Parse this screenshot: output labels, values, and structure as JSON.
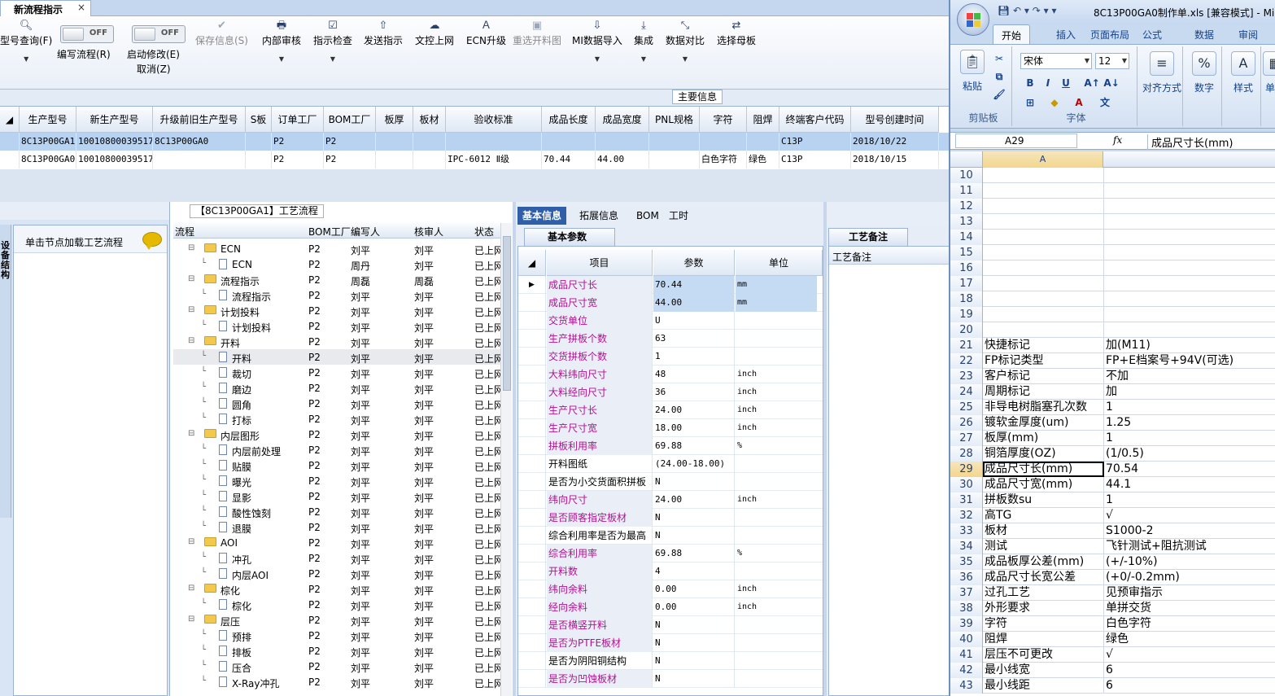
{
  "app": {
    "tab_title": "新流程指示",
    "tab_close": "×",
    "ribbon": {
      "query": "型号查询(F)",
      "edit_flow": "编写流程(R)",
      "start_modify": "启动修改(E)",
      "cancel": "取消(Z)",
      "toggle_off_1": "OFF",
      "toggle_off_2": "OFF",
      "save_info": "保存信息(S)",
      "internal_review": "内部审核",
      "instruction_check": "指示检查",
      "send_instruction": "发送指示",
      "file_upload": "文控上网",
      "ecn_upgrade": "ECN升级",
      "reselect_panel": "重选开料图",
      "mi_import": "MI数据导入",
      "integrate": "集成",
      "data_compare": "数据对比",
      "select_master": "选择母板"
    },
    "main_info_label": "主要信息",
    "top_grid": {
      "headers": [
        "生产型号",
        "新生产型号",
        "升级前旧生产型号",
        "S板",
        "订单工厂",
        "BOM工厂",
        "板厚",
        "板材",
        "验收标准",
        "成品长度",
        "成品宽度",
        "PNL规格",
        "字符",
        "阻焊",
        "终端客户代码",
        "型号创建时间"
      ],
      "rows": [
        [
          "8C13P00GA1",
          "10010800039517",
          "8C13P00GA0",
          "",
          "P2",
          "P2",
          "",
          "",
          "",
          "",
          "",
          "",
          "",
          "",
          "C13P",
          "2018/10/22"
        ],
        [
          "8C13P00GA0",
          "10010800039517",
          "",
          "",
          "P2",
          "P2",
          "",
          "",
          "IPC-6012 Ⅱ级",
          "70.44",
          "44.00",
          "",
          "白色字符",
          "绿色",
          "C13P",
          "2018/10/15"
        ]
      ]
    },
    "node_panel": {
      "side_tab": "设备结构",
      "hint": "单击节点加载工艺流程"
    },
    "tree": {
      "caption": "【8C13P00GA1】工艺流程",
      "headers": [
        "流程",
        "BOM工厂",
        "编写人",
        "核审人",
        "状态"
      ],
      "rows": [
        {
          "name": "ECN",
          "level": 0,
          "bom": "P2",
          "writer": "刘平",
          "reviewer": "刘平",
          "status": "已上网"
        },
        {
          "name": "ECN",
          "level": 1,
          "bom": "P2",
          "writer": "周丹",
          "reviewer": "刘平",
          "status": "已上网"
        },
        {
          "name": "流程指示",
          "level": 0,
          "bom": "P2",
          "writer": "周磊",
          "reviewer": "周磊",
          "status": "已上网"
        },
        {
          "name": "流程指示",
          "level": 1,
          "bom": "P2",
          "writer": "刘平",
          "reviewer": "刘平",
          "status": "已上网"
        },
        {
          "name": "计划投料",
          "level": 0,
          "bom": "P2",
          "writer": "刘平",
          "reviewer": "刘平",
          "status": "已上网"
        },
        {
          "name": "计划投料",
          "level": 1,
          "bom": "P2",
          "writer": "刘平",
          "reviewer": "刘平",
          "status": "已上网"
        },
        {
          "name": "开料",
          "level": 0,
          "bom": "P2",
          "writer": "刘平",
          "reviewer": "刘平",
          "status": "已上网"
        },
        {
          "name": "开料",
          "level": 1,
          "bom": "P2",
          "writer": "刘平",
          "reviewer": "刘平",
          "status": "已上网"
        },
        {
          "name": "裁切",
          "level": 1,
          "bom": "P2",
          "writer": "刘平",
          "reviewer": "刘平",
          "status": "已上网"
        },
        {
          "name": "磨边",
          "level": 1,
          "bom": "P2",
          "writer": "刘平",
          "reviewer": "刘平",
          "status": "已上网"
        },
        {
          "name": "圆角",
          "level": 1,
          "bom": "P2",
          "writer": "刘平",
          "reviewer": "刘平",
          "status": "已上网"
        },
        {
          "name": "打标",
          "level": 1,
          "bom": "P2",
          "writer": "刘平",
          "reviewer": "刘平",
          "status": "已上网"
        },
        {
          "name": "内层图形",
          "level": 0,
          "bom": "P2",
          "writer": "刘平",
          "reviewer": "刘平",
          "status": "已上网"
        },
        {
          "name": "内层前处理",
          "level": 1,
          "bom": "P2",
          "writer": "刘平",
          "reviewer": "刘平",
          "status": "已上网"
        },
        {
          "name": "贴膜",
          "level": 1,
          "bom": "P2",
          "writer": "刘平",
          "reviewer": "刘平",
          "status": "已上网"
        },
        {
          "name": "曝光",
          "level": 1,
          "bom": "P2",
          "writer": "刘平",
          "reviewer": "刘平",
          "status": "已上网"
        },
        {
          "name": "显影",
          "level": 1,
          "bom": "P2",
          "writer": "刘平",
          "reviewer": "刘平",
          "status": "已上网"
        },
        {
          "name": "酸性蚀刻",
          "level": 1,
          "bom": "P2",
          "writer": "刘平",
          "reviewer": "刘平",
          "status": "已上网"
        },
        {
          "name": "退膜",
          "level": 1,
          "bom": "P2",
          "writer": "刘平",
          "reviewer": "刘平",
          "status": "已上网"
        },
        {
          "name": "AOI",
          "level": 0,
          "bom": "P2",
          "writer": "刘平",
          "reviewer": "刘平",
          "status": "已上网"
        },
        {
          "name": "冲孔",
          "level": 1,
          "bom": "P2",
          "writer": "刘平",
          "reviewer": "刘平",
          "status": "已上网"
        },
        {
          "name": "内层AOI",
          "level": 1,
          "bom": "P2",
          "writer": "刘平",
          "reviewer": "刘平",
          "status": "已上网"
        },
        {
          "name": "棕化",
          "level": 0,
          "bom": "P2",
          "writer": "刘平",
          "reviewer": "刘平",
          "status": "已上网"
        },
        {
          "name": "棕化",
          "level": 1,
          "bom": "P2",
          "writer": "刘平",
          "reviewer": "刘平",
          "status": "已上网"
        },
        {
          "name": "层压",
          "level": 0,
          "bom": "P2",
          "writer": "刘平",
          "reviewer": "刘平",
          "status": "已上网"
        },
        {
          "name": "预排",
          "level": 1,
          "bom": "P2",
          "writer": "刘平",
          "reviewer": "刘平",
          "status": "已上网"
        },
        {
          "name": "排板",
          "level": 1,
          "bom": "P2",
          "writer": "刘平",
          "reviewer": "刘平",
          "status": "已上网"
        },
        {
          "name": "压合",
          "level": 1,
          "bom": "P2",
          "writer": "刘平",
          "reviewer": "刘平",
          "status": "已上网"
        },
        {
          "name": "X-Ray冲孔",
          "level": 1,
          "bom": "P2",
          "writer": "刘平",
          "reviewer": "刘平",
          "status": "已上网"
        }
      ]
    },
    "params": {
      "tabs": [
        "基本信息",
        "拓展信息",
        "BOM",
        "工时"
      ],
      "sub_tab": "基本参数",
      "headers": [
        "项目",
        "参数",
        "单位"
      ],
      "rows": [
        {
          "name": "成品尺寸长",
          "value": "70.44",
          "unit": "mm",
          "req": true
        },
        {
          "name": "成品尺寸宽",
          "value": "44.00",
          "unit": "mm",
          "req": true
        },
        {
          "name": "交货单位",
          "value": "U",
          "unit": "",
          "req": true
        },
        {
          "name": "生产拼板个数",
          "value": "63",
          "unit": "",
          "req": true
        },
        {
          "name": "交货拼板个数",
          "value": "1",
          "unit": "",
          "req": true
        },
        {
          "name": "大料纬向尺寸",
          "value": "48",
          "unit": "inch",
          "req": true
        },
        {
          "name": "大料经向尺寸",
          "value": "36",
          "unit": "inch",
          "req": true
        },
        {
          "name": "生产尺寸长",
          "value": "24.00",
          "unit": "inch",
          "req": true
        },
        {
          "name": "生产尺寸宽",
          "value": "18.00",
          "unit": "inch",
          "req": true
        },
        {
          "name": "拼板利用率",
          "value": "69.88",
          "unit": "%",
          "req": true
        },
        {
          "name": "开料图纸",
          "value": "(24.00-18.00)",
          "unit": "",
          "req": false
        },
        {
          "name": "是否为小交货面积拼板",
          "value": "N",
          "unit": "",
          "req": false
        },
        {
          "name": "纬向尺寸",
          "value": "24.00",
          "unit": "inch",
          "req": true
        },
        {
          "name": "是否顾客指定板材",
          "value": "N",
          "unit": "",
          "req": true
        },
        {
          "name": "综合利用率是否为最高",
          "value": "N",
          "unit": "",
          "req": false
        },
        {
          "name": "综合利用率",
          "value": "69.88",
          "unit": "%",
          "req": true
        },
        {
          "name": "开料数",
          "value": "4",
          "unit": "",
          "req": true
        },
        {
          "name": "纬向余料",
          "value": "0.00",
          "unit": "inch",
          "req": true
        },
        {
          "name": "经向余料",
          "value": "0.00",
          "unit": "inch",
          "req": true
        },
        {
          "name": "是否横竖开料",
          "value": "N",
          "unit": "",
          "req": true
        },
        {
          "name": "是否为PTFE板材",
          "value": "N",
          "unit": "",
          "req": true
        },
        {
          "name": "是否为阴阳铜结构",
          "value": "N",
          "unit": "",
          "req": false
        },
        {
          "name": "是否为凹蚀板材",
          "value": "N",
          "unit": "",
          "req": true
        }
      ]
    },
    "notes": {
      "tab": "工艺备注",
      "label": "工艺备注"
    }
  },
  "excel": {
    "title": "8C13P00GA0制作单.xls  [兼容模式] - Mic",
    "tabs": [
      "开始",
      "插入",
      "页面布局",
      "公式",
      "数据",
      "审阅"
    ],
    "ribbon": {
      "paste": "粘贴",
      "clipboard": "剪贴板",
      "font_name": "宋体",
      "font_size": "12",
      "font_group": "字体",
      "align": "对齐方式",
      "number": "数字",
      "style": "样式",
      "cells": "单元"
    },
    "name_box": "A29",
    "formula": "成品尺寸长(mm)",
    "col_a": "A",
    "rows": [
      {
        "n": "10",
        "a": "",
        "b": ""
      },
      {
        "n": "11",
        "a": "",
        "b": ""
      },
      {
        "n": "12",
        "a": "",
        "b": ""
      },
      {
        "n": "13",
        "a": "",
        "b": ""
      },
      {
        "n": "14",
        "a": "",
        "b": ""
      },
      {
        "n": "15",
        "a": "",
        "b": ""
      },
      {
        "n": "16",
        "a": "",
        "b": ""
      },
      {
        "n": "17",
        "a": "",
        "b": ""
      },
      {
        "n": "18",
        "a": "",
        "b": ""
      },
      {
        "n": "19",
        "a": "",
        "b": ""
      },
      {
        "n": "20",
        "a": "",
        "b": ""
      },
      {
        "n": "21",
        "a": "快捷标记",
        "b": "加(M11)"
      },
      {
        "n": "22",
        "a": "FP标记类型",
        "b": "FP+E档案号+94V(可选)"
      },
      {
        "n": "23",
        "a": "客户标记",
        "b": "不加"
      },
      {
        "n": "24",
        "a": "周期标记",
        "b": "加"
      },
      {
        "n": "25",
        "a": "非导电树脂塞孔次数",
        "b": "1"
      },
      {
        "n": "26",
        "a": "镀软金厚度(um)",
        "b": "1.25"
      },
      {
        "n": "27",
        "a": "板厚(mm)",
        "b": "1"
      },
      {
        "n": "28",
        "a": "铜箔厚度(OZ)",
        "b": "(1/0.5)"
      },
      {
        "n": "29",
        "a": "成品尺寸长(mm)",
        "b": "70.54"
      },
      {
        "n": "30",
        "a": "成品尺寸宽(mm)",
        "b": "44.1"
      },
      {
        "n": "31",
        "a": "拼板数su",
        "b": "1"
      },
      {
        "n": "32",
        "a": "高TG",
        "b": "√"
      },
      {
        "n": "33",
        "a": "板材",
        "b": "S1000-2"
      },
      {
        "n": "34",
        "a": "测试",
        "b": "飞针测试+阻抗测试"
      },
      {
        "n": "35",
        "a": "成品板厚公差(mm)",
        "b": "(+/-10%)"
      },
      {
        "n": "36",
        "a": "成品尺寸长宽公差",
        "b": "(+0/-0.2mm)"
      },
      {
        "n": "37",
        "a": "过孔工艺",
        "b": "见预审指示"
      },
      {
        "n": "38",
        "a": "外形要求",
        "b": "单拼交货"
      },
      {
        "n": "39",
        "a": "字符",
        "b": "白色字符"
      },
      {
        "n": "40",
        "a": "阻焊",
        "b": "绿色"
      },
      {
        "n": "41",
        "a": "层压不可更改",
        "b": "√"
      },
      {
        "n": "42",
        "a": "最小线宽",
        "b": "6"
      },
      {
        "n": "43",
        "a": "最小线距",
        "b": "6"
      }
    ]
  }
}
